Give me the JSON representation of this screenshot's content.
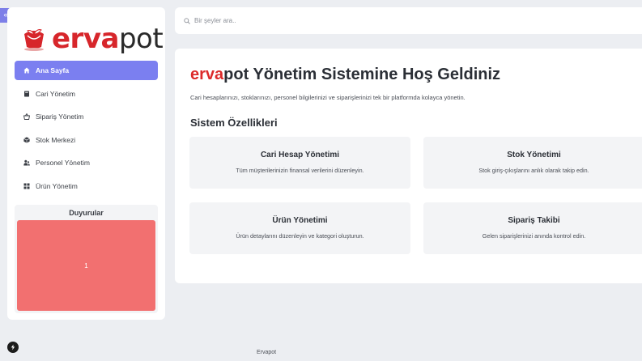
{
  "app": {
    "brand_part1": "erva",
    "brand_part2": "pot",
    "collapse_glyph": "«"
  },
  "sidebar": {
    "items": [
      {
        "label": "Ana Sayfa",
        "icon": "home-icon",
        "active": true
      },
      {
        "label": "Cari Yönetim",
        "icon": "book-icon",
        "active": false
      },
      {
        "label": "Sipariş Yönetim",
        "icon": "basket-icon",
        "active": false
      },
      {
        "label": "Stok Merkezi",
        "icon": "box-icon",
        "active": false
      },
      {
        "label": "Personel Yönetim",
        "icon": "users-icon",
        "active": false
      },
      {
        "label": "Ürün Yönetim",
        "icon": "grid-icon",
        "active": false
      }
    ],
    "announcements": {
      "title": "Duyurular",
      "card_text": "1",
      "card_color": "#f27070"
    }
  },
  "search": {
    "placeholder": "Bir şeyler ara.."
  },
  "main": {
    "welcome_brand": "erva",
    "welcome_rest": "pot Yönetim Sistemine Hoş Geldiniz",
    "description": "Cari hesaplarınızı, stoklarınızı, personel bilgilerinizi ve siparişlerinizi tek bir platformda kolayca yönetin.",
    "section_title": "Sistem Özellikleri",
    "features": [
      {
        "title": "Cari Hesap Yönetimi",
        "desc": "Tüm müşterilerinizin finansal verilerini düzenleyin."
      },
      {
        "title": "Stok Yönetimi",
        "desc": "Stok giriş-çıkışlarını anlık olarak takip edin."
      },
      {
        "title": "Ürün Yönetimi",
        "desc": "Ürün detaylarını düzenleyin ve kategori oluşturun."
      },
      {
        "title": "Sipariş Takibi",
        "desc": "Gelen siparişlerinizi anında kontrol edin."
      }
    ]
  },
  "footer": {
    "text": "Ervapot"
  },
  "colors": {
    "accent": "#7b7ff0",
    "brand_red": "#dc2a2a",
    "background": "#eceef2"
  }
}
